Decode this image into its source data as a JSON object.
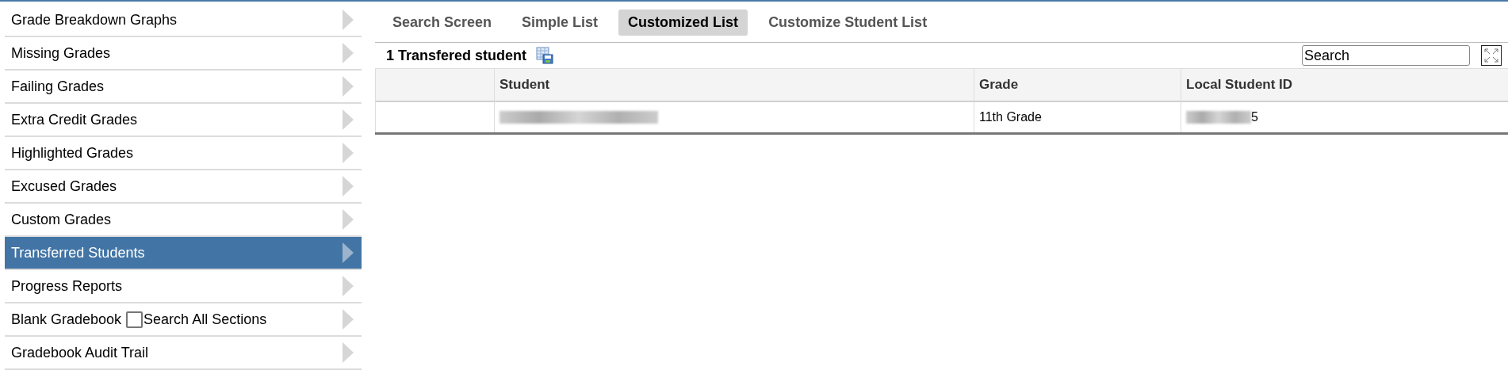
{
  "sidebar": {
    "items": [
      {
        "label": "Grade Breakdown Graphs",
        "selected": false
      },
      {
        "label": "Missing Grades",
        "selected": false
      },
      {
        "label": "Failing Grades",
        "selected": false
      },
      {
        "label": "Extra Credit Grades",
        "selected": false
      },
      {
        "label": "Highlighted Grades",
        "selected": false
      },
      {
        "label": "Excused Grades",
        "selected": false
      },
      {
        "label": "Custom Grades",
        "selected": false
      },
      {
        "label": "Transferred Students",
        "selected": true
      },
      {
        "label": "Progress Reports",
        "selected": false
      },
      {
        "label": "Blank Gradebook",
        "selected": false,
        "option": {
          "label": "Search All Sections",
          "checked": false
        }
      },
      {
        "label": "Gradebook Audit Trail",
        "selected": false
      }
    ]
  },
  "tabs": [
    {
      "label": "Search Screen",
      "selected": false
    },
    {
      "label": "Simple List",
      "selected": false
    },
    {
      "label": "Customized List",
      "selected": true
    },
    {
      "label": "Customize Student List",
      "selected": false
    }
  ],
  "list": {
    "title": "1 Transfered student",
    "search": {
      "value": "Search"
    },
    "columns": [
      "Student",
      "Grade",
      "Local Student ID"
    ],
    "rows": [
      {
        "student": {
          "redacted": true
        },
        "grade": "11th Grade",
        "local_id": {
          "redacted": true,
          "visible": "5"
        }
      }
    ]
  }
}
